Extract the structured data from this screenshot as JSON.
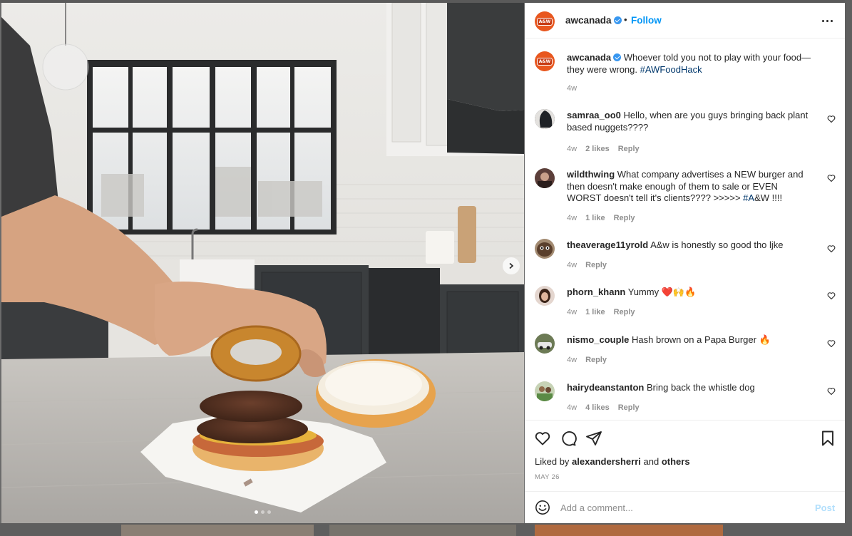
{
  "post": {
    "username": "awcanada",
    "follow_label": "Follow",
    "separator": "•",
    "logo_text": "A&W",
    "caption": {
      "text": "Whoever told you not to play with your food—they were wrong.",
      "hashtag": "#AWFoodHack",
      "time": "4w"
    }
  },
  "comments": [
    {
      "user": "samraa_oo0",
      "text": "Hello, when are you guys bringing back plant based nuggets????",
      "time": "4w",
      "likes": "2 likes",
      "reply": "Reply"
    },
    {
      "user": "wildthwing",
      "text": "What company advertises a NEW burger and then doesn't make enough of them to sale or EVEN WORST doesn't tell it's clients???? >>>>>",
      "mention": "#A",
      "text_after": "&W !!!!",
      "time": "4w",
      "likes": "1 like",
      "reply": "Reply"
    },
    {
      "user": "theaverage11yrold",
      "text": "A&w is honestly so good tho ljke",
      "time": "4w",
      "reply": "Reply"
    },
    {
      "user": "phorn_khann",
      "text": "Yummy ❤️🙌🔥",
      "time": "4w",
      "likes": "1 like",
      "reply": "Reply"
    },
    {
      "user": "nismo_couple",
      "text": "Hash brown on a Papa Burger 🔥",
      "time": "4w",
      "reply": "Reply"
    },
    {
      "user": "hairydeanstanton",
      "text": "Bring back the whistle dog",
      "time": "4w",
      "likes": "4 likes",
      "reply": "Reply"
    }
  ],
  "liked_by": {
    "prefix": "Liked by",
    "user": "alexandersherri",
    "and": "and",
    "others": "others"
  },
  "date": "MAY 26",
  "add_comment": {
    "placeholder": "Add a comment...",
    "post_label": "Post"
  },
  "icons": [
    "more-options-icon",
    "heart-icon",
    "comment-icon",
    "share-icon",
    "bookmark-icon",
    "emoji-icon",
    "chevron-right-icon",
    "verified-badge-icon"
  ],
  "colors": {
    "follow": "#0095f6",
    "verified": "#3897f0",
    "brand": "#e8571f",
    "hashtag": "#00376b",
    "post_disabled": "#b2dffc"
  }
}
